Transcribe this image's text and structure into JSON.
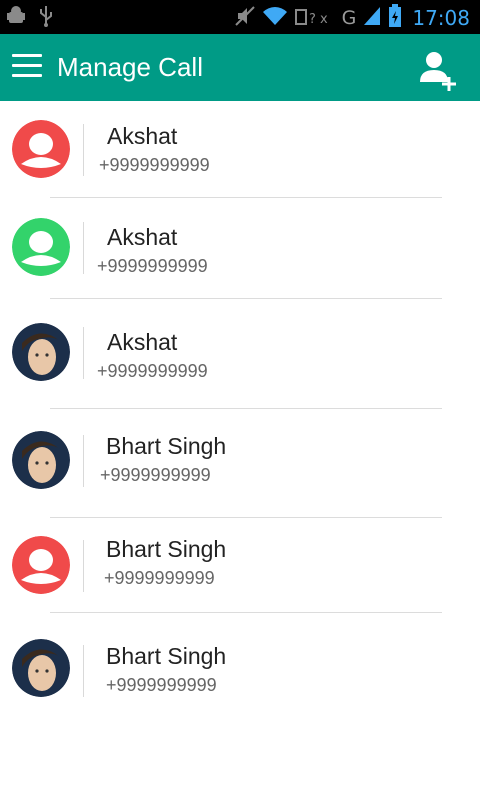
{
  "status_bar": {
    "time": "17:08",
    "network_label": "G",
    "icons": [
      "android-debug-icon",
      "usb-icon",
      "mute-icon",
      "wifi-icon",
      "sim-icon",
      "signal-icon",
      "battery-icon"
    ]
  },
  "app_bar": {
    "title": "Manage Call",
    "color": "#009b86",
    "icons": [
      "menu-icon",
      "add-contact-icon"
    ]
  },
  "contacts": [
    {
      "name": "Akshat",
      "phone": "+9999999999",
      "avatar": "red-placeholder"
    },
    {
      "name": "Akshat",
      "phone": "+9999999999",
      "avatar": "green-placeholder"
    },
    {
      "name": "Akshat",
      "phone": "+9999999999",
      "avatar": "photo"
    },
    {
      "name": "Bhart Singh",
      "phone": "+9999999999",
      "avatar": "photo"
    },
    {
      "name": "Bhart Singh",
      "phone": "+9999999999",
      "avatar": "red-placeholder"
    },
    {
      "name": "Bhart Singh",
      "phone": "+9999999999",
      "avatar": "photo"
    }
  ],
  "colors": {
    "red_avatar": "#f04a4a",
    "green_avatar": "#33d36b"
  }
}
